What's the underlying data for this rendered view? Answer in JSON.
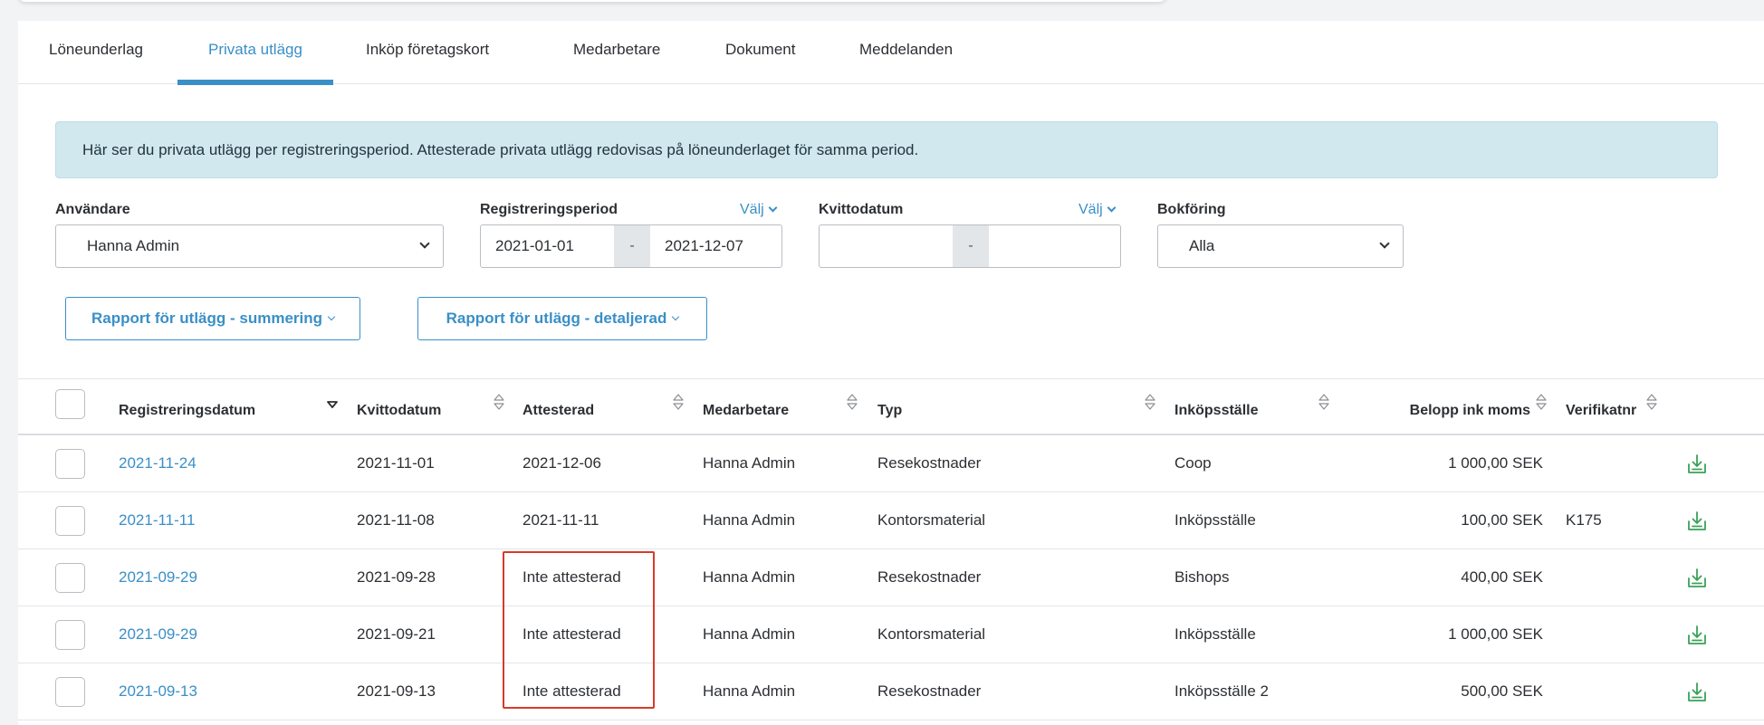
{
  "tabs": [
    {
      "label": "Löneunderlag",
      "active": false
    },
    {
      "label": "Privata utlägg",
      "active": true
    },
    {
      "label": "Inköp företagskort",
      "active": false
    },
    {
      "label": "Medarbetare",
      "active": false
    },
    {
      "label": "Dokument",
      "active": false
    },
    {
      "label": "Meddelanden",
      "active": false
    }
  ],
  "info_text": "Här ser du privata utlägg per registreringsperiod. Attesterade privata utlägg redovisas på löneunderlaget för samma period.",
  "filters": {
    "user": {
      "label": "Användare",
      "value": "Hanna Admin"
    },
    "period": {
      "label": "Registreringsperiod",
      "choose": "Välj",
      "from": "2021-01-01",
      "separator": "-",
      "to": "2021-12-07"
    },
    "receipt_date": {
      "label": "Kvittodatum",
      "choose": "Välj",
      "from": "",
      "separator": "-",
      "to": ""
    },
    "booking": {
      "label": "Bokföring",
      "value": "Alla"
    }
  },
  "buttons": {
    "report_summary": "Rapport för utlägg - summering",
    "report_detailed": "Rapport för utlägg - detaljerad"
  },
  "table": {
    "headers": {
      "registered": "Registreringsdatum",
      "receipt": "Kvittodatum",
      "attested": "Attesterad",
      "employee": "Medarbetare",
      "type": "Typ",
      "place": "Inköpsställe",
      "amount": "Belopp ink moms",
      "voucher": "Verifikatnr"
    },
    "rows": [
      {
        "registered": "2021-11-24",
        "receipt": "2021-11-01",
        "attested": "2021-12-06",
        "employee": "Hanna Admin",
        "type": "Resekostnader",
        "place": "Coop",
        "amount": "1 000,00 SEK",
        "voucher": ""
      },
      {
        "registered": "2021-11-11",
        "receipt": "2021-11-08",
        "attested": "2021-11-11",
        "employee": "Hanna Admin",
        "type": "Kontorsmaterial",
        "place": "Inköpsställe",
        "amount": "100,00 SEK",
        "voucher": "K175"
      },
      {
        "registered": "2021-09-29",
        "receipt": "2021-09-28",
        "attested": "Inte attesterad",
        "employee": "Hanna Admin",
        "type": "Resekostnader",
        "place": "Bishops",
        "amount": "400,00 SEK",
        "voucher": ""
      },
      {
        "registered": "2021-09-29",
        "receipt": "2021-09-21",
        "attested": "Inte attesterad",
        "employee": "Hanna Admin",
        "type": "Kontorsmaterial",
        "place": "Inköpsställe",
        "amount": "1 000,00 SEK",
        "voucher": ""
      },
      {
        "registered": "2021-09-13",
        "receipt": "2021-09-13",
        "attested": "Inte attesterad",
        "employee": "Hanna Admin",
        "type": "Resekostnader",
        "place": "Inköpsställe 2",
        "amount": "500,00 SEK",
        "voucher": ""
      }
    ]
  },
  "colors": {
    "accent": "#3a8fc7",
    "info_bg": "#d1e8ef",
    "highlight": "#d63b2a",
    "download_icon": "#3aa157"
  },
  "icons": {
    "download": "download-icon",
    "sort": "sort-icon",
    "sort_desc": "sort-desc-icon",
    "chevron": "chevron-down-icon"
  }
}
